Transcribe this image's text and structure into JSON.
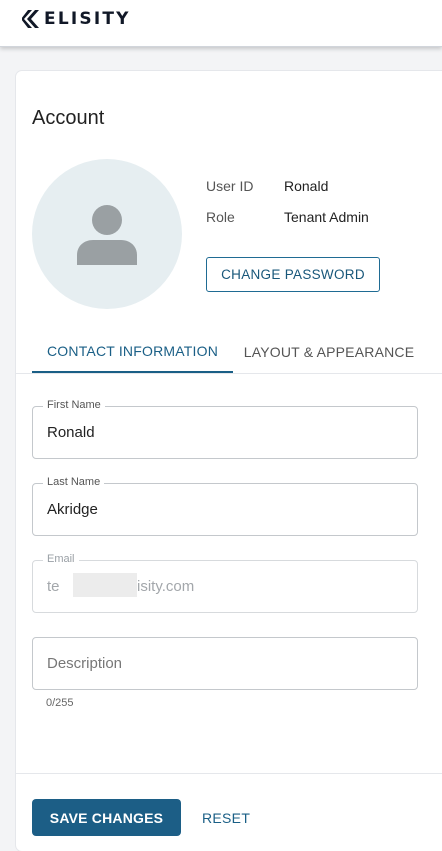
{
  "header": {
    "brand_name": "ELISITY",
    "brand_icon": "elisity-logo-icon"
  },
  "account": {
    "title": "Account",
    "avatar_icon": "person-icon",
    "user_id_label": "User ID",
    "user_id_value": "Ronald",
    "role_label": "Role",
    "role_value": "Tenant Admin",
    "change_password_label": "CHANGE PASSWORD"
  },
  "tabs": [
    {
      "label": "CONTACT INFORMATION",
      "active": true
    },
    {
      "label": "LAYOUT & APPEARANCE",
      "active": false
    }
  ],
  "form": {
    "first_name": {
      "label": "First Name",
      "value": "Ronald"
    },
    "last_name": {
      "label": "Last Name",
      "value": "Akridge"
    },
    "email": {
      "label": "Email",
      "value_prefix": "te",
      "value_suffix": "isity.com",
      "disabled": true
    },
    "description": {
      "placeholder": "Description",
      "value": "",
      "counter": "0/255"
    }
  },
  "actions": {
    "save_label": "SAVE CHANGES",
    "reset_label": "RESET"
  },
  "colors": {
    "accent": "#1c5e86",
    "avatar_bg": "#e6eef1",
    "avatar_fg": "#9aa0a3"
  }
}
